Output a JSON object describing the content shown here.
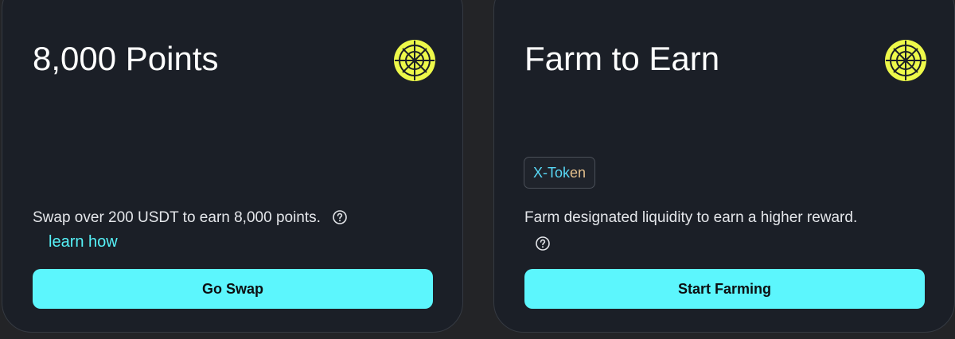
{
  "cards": [
    {
      "title": "8,000 Points",
      "description": "Swap over 200 USDT to earn 8,000 points.",
      "link_label": "learn how",
      "button_label": "Go Swap",
      "logo_icon": "crosshair-coin-logo",
      "help_icon": "question-circle-icon"
    },
    {
      "title": "Farm to Earn",
      "tag": {
        "main": "X-Tok",
        "accent": "en"
      },
      "description": "Farm designated liquidity to earn a higher reward.",
      "button_label": "Start Farming",
      "logo_icon": "crosshair-coin-logo",
      "help_icon": "question-circle-icon"
    }
  ],
  "colors": {
    "page_background": "#232427",
    "card_background": "#1b1f27",
    "card_border": "#353a42",
    "accent_cyan": "#5cf6fd",
    "link_cyan": "#56f2f8",
    "logo_yellow": "#eef94a",
    "tag_text": "#58d8f6",
    "tag_accent": "#e3bf8c"
  }
}
